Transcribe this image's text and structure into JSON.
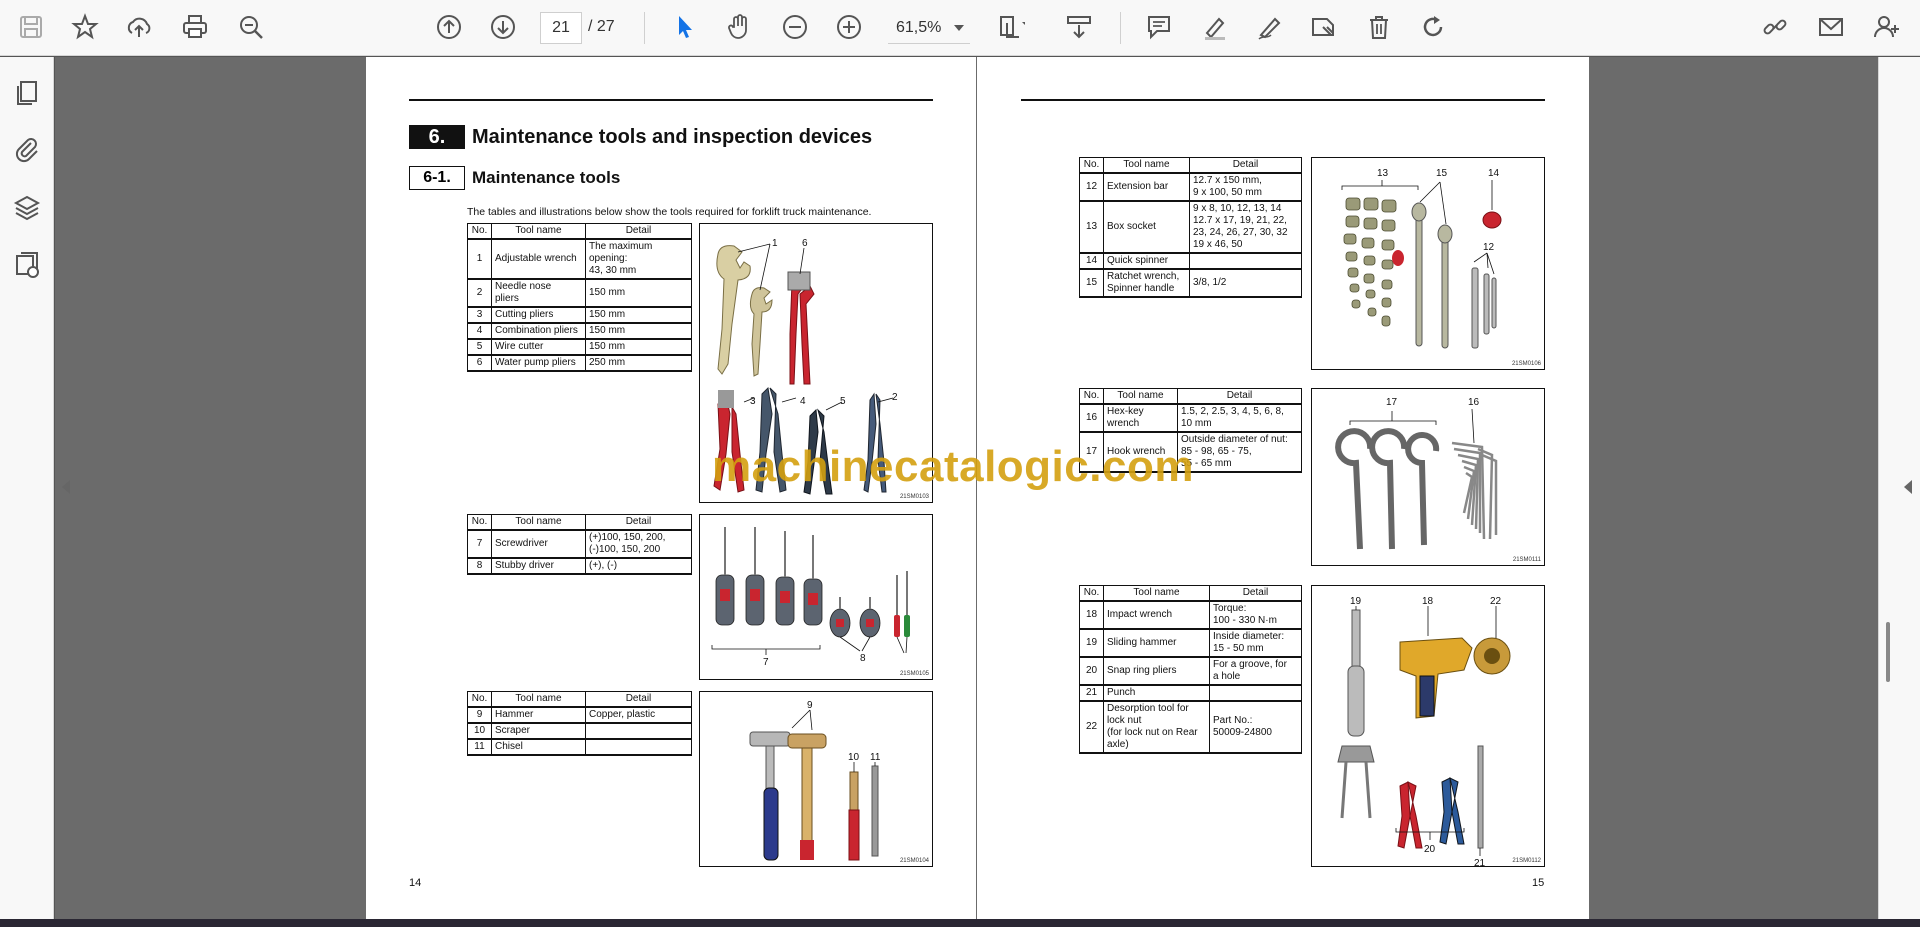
{
  "toolbar": {
    "left_icons": [
      "save-icon",
      "bookmark-star-icon",
      "upload-icon",
      "print-icon",
      "zoom-search-icon"
    ],
    "nav_icons": [
      "previous-page-icon",
      "next-page-icon"
    ],
    "current_page": "21",
    "page_sep": "/",
    "total_pages": "27",
    "tool_icons": [
      "select-cursor-icon",
      "hand-tool-icon",
      "zoom-out-icon",
      "zoom-in-icon"
    ],
    "zoom": "61,5%",
    "view_icons": [
      "page-fit-icon",
      "scroll-mode-icon"
    ],
    "annot_icons": [
      "comment-icon",
      "highlight-icon",
      "draw-icon",
      "stamp-icon",
      "delete-icon",
      "rotate-icon"
    ],
    "right_icons": [
      "share-link-icon",
      "email-icon",
      "add-user-icon"
    ]
  },
  "left_rail_icons": [
    "page-thumbnails-icon",
    "attachments-icon",
    "layers-icon",
    "page-info-icon"
  ],
  "page14": {
    "section_num": "6.",
    "section_title": "Maintenance tools and inspection devices",
    "sub_num": "6-1.",
    "sub_title": "Maintenance tools",
    "intro": "The tables and illustrations below show the tools required for forklift truck maintenance.",
    "headers": [
      "No.",
      "Tool name",
      "Detail"
    ],
    "table1": [
      {
        "no": "1",
        "name": "Adjustable wrench",
        "detail": "The maximum\nopening:\n 43, 30 mm"
      },
      {
        "no": "2",
        "name": "Needle nose\npliers",
        "detail": "150 mm"
      },
      {
        "no": "3",
        "name": "Cutting pliers",
        "detail": "150 mm"
      },
      {
        "no": "4",
        "name": "Combination pliers",
        "detail": "150 mm"
      },
      {
        "no": "5",
        "name": "Wire cutter",
        "detail": "150 mm"
      },
      {
        "no": "6",
        "name": "Water pump pliers",
        "detail": "250 mm"
      }
    ],
    "table2": [
      {
        "no": "7",
        "name": "Screwdriver",
        "detail": "(+)100, 150, 200,\n(-)100, 150, 200"
      },
      {
        "no": "8",
        "name": "Stubby driver",
        "detail": "(+), (-)"
      }
    ],
    "table3": [
      {
        "no": "9",
        "name": "Hammer",
        "detail": "Copper, plastic"
      },
      {
        "no": "10",
        "name": "Scraper",
        "detail": ""
      },
      {
        "no": "11",
        "name": "Chisel",
        "detail": ""
      }
    ],
    "fig1_code": "21SM0103",
    "fig2_code": "21SM0105",
    "fig3_code": "21SM0104",
    "page_number": "14"
  },
  "page15": {
    "headers": [
      "No.",
      "Tool name",
      "Detail"
    ],
    "table4": [
      {
        "no": "12",
        "name": "Extension bar",
        "detail": "12.7 x 150 mm,\n9 x 100, 50 mm"
      },
      {
        "no": "13",
        "name": "Box socket",
        "detail": "9 x 8, 10, 12, 13, 14\n12.7 x 17, 19, 21, 22,\n23, 24, 26, 27, 30, 32\n19 x 46, 50"
      },
      {
        "no": "14",
        "name": "Quick spinner",
        "detail": ""
      },
      {
        "no": "15",
        "name": "Ratchet wrench,\nSpinner handle",
        "detail": "3/8, 1/2"
      }
    ],
    "table5": [
      {
        "no": "16",
        "name": "Hex-key\nwrench",
        "detail": "1.5, 2, 2.5, 3, 4, 5, 6, 8,\n10 mm"
      },
      {
        "no": "17",
        "name": "Hook wrench",
        "detail": "Outside diameter of nut:\n85 - 98, 65 - 75,\n55 - 65 mm"
      }
    ],
    "table6": [
      {
        "no": "18",
        "name": "Impact wrench",
        "detail": "Torque:\n100 - 330 N·m"
      },
      {
        "no": "19",
        "name": "Sliding hammer",
        "detail": "Inside diameter:\n15 - 50 mm"
      },
      {
        "no": "20",
        "name": "Snap ring pliers",
        "detail": "For a groove, for\na hole"
      },
      {
        "no": "21",
        "name": "Punch",
        "detail": ""
      },
      {
        "no": "22",
        "name": "Desorption tool for\nlock nut\n(for lock nut on Rear\naxle)",
        "detail": "Part No.:\n50009-24800"
      }
    ],
    "fig4_code": "21SM0106",
    "fig5_code": "21SM0111",
    "fig6_code": "21SM0112",
    "page_number": "15"
  },
  "callouts": {
    "fig1": [
      "1",
      "6",
      "3",
      "4",
      "5",
      "2"
    ],
    "fig2": [
      "7",
      "8"
    ],
    "fig3": [
      "9",
      "10",
      "11"
    ],
    "fig4": [
      "13",
      "15",
      "14",
      "12"
    ],
    "fig5": [
      "17",
      "16"
    ],
    "fig6": [
      "19",
      "18",
      "22",
      "20",
      "21"
    ]
  },
  "watermark": "machinecatalogic.com",
  "colors": {
    "accent_blue": "#1473e6",
    "watermark": "#d4a010"
  }
}
